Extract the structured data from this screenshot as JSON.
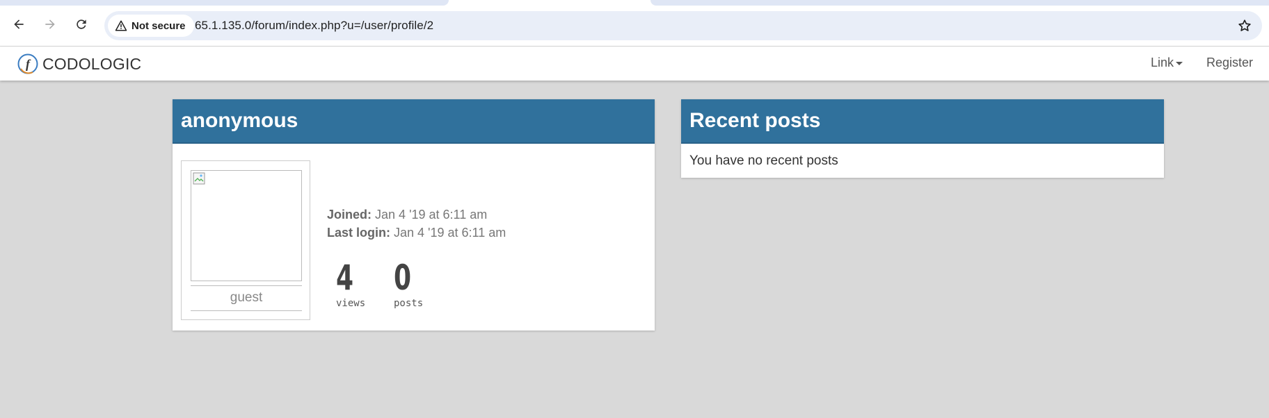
{
  "browser": {
    "security_label": "Not secure",
    "url": "65.1.135.0/forum/index.php?u=/user/profile/2",
    "icons": [
      "back-icon",
      "forward-icon",
      "reload-icon",
      "warning-icon",
      "bookmark-star-icon"
    ]
  },
  "navbar": {
    "brand": "CODOLOGIC",
    "link_label": "Link",
    "register_label": "Register"
  },
  "profile": {
    "username": "anonymous",
    "role": "guest",
    "joined_label": "Joined:",
    "joined_value": "Jan 4 '19 at 6:11 am",
    "last_login_label": "Last login:",
    "last_login_value": "Jan 4 '19 at 6:11 am",
    "views_count": "4",
    "views_label": "views",
    "posts_count": "0",
    "posts_label": "posts"
  },
  "recent_posts": {
    "title": "Recent posts",
    "empty_message": "You have no recent posts"
  },
  "colors": {
    "panel_header": "#30719c",
    "page_background": "#d9d9d9"
  }
}
